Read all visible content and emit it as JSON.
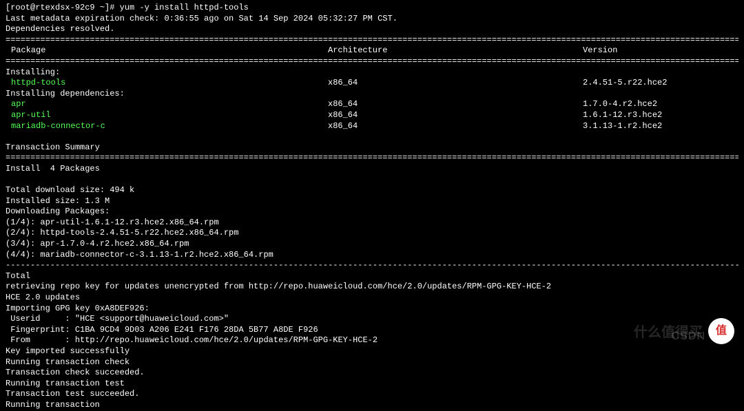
{
  "prompt": "[root@rtexdsx-92c9 ~]# yum -y install httpd-tools",
  "meta_expire": "Last metadata expiration check: 0:36:55 ago on Sat 14 Sep 2024 05:32:27 PM CST.",
  "deps_resolved": "Dependencies resolved.",
  "headers": {
    "pkg": "Package",
    "arch": "Architecture",
    "ver": "Version"
  },
  "installing_label": "Installing:",
  "installing": [
    {
      "name": "httpd-tools",
      "arch": "x86_64",
      "ver": "2.4.51-5.r22.hce2"
    }
  ],
  "deps_label": "Installing dependencies:",
  "deps": [
    {
      "name": "apr",
      "arch": "x86_64",
      "ver": "1.7.0-4.r2.hce2"
    },
    {
      "name": "apr-util",
      "arch": "x86_64",
      "ver": "1.6.1-12.r3.hce2"
    },
    {
      "name": "mariadb-connector-c",
      "arch": "x86_64",
      "ver": "3.1.13-1.r2.hce2"
    }
  ],
  "summary_label": "Transaction Summary",
  "install_count": "Install  4 Packages",
  "dl_size": "Total download size: 494 k",
  "inst_size": "Installed size: 1.3 M",
  "dl_label": "Downloading Packages:",
  "downloads": [
    "(1/4): apr-util-1.6.1-12.r3.hce2.x86_64.rpm",
    "(2/4): httpd-tools-2.4.51-5.r22.hce2.x86_64.rpm",
    "(3/4): apr-1.7.0-4.r2.hce2.x86_64.rpm",
    "(4/4): mariadb-connector-c-3.1.13-1.r2.hce2.x86_64.rpm"
  ],
  "total": "Total",
  "repo_key": "retrieving repo key for updates unencrypted from http://repo.huaweicloud.com/hce/2.0/updates/RPM-GPG-KEY-HCE-2",
  "hce": "HCE 2.0 updates",
  "gpg_import": "Importing GPG key 0xA8DEF926:",
  "gpg_userid": " Userid     : \"HCE <support@huaweicloud.com>\"",
  "gpg_fp": " Fingerprint: C1BA 9CD4 9D03 A206 E241 F176 28DA 5B77 A8DE F926",
  "gpg_from": " From       : http://repo.huaweicloud.com/hce/2.0/updates/RPM-GPG-KEY-HCE-2",
  "trail": [
    "Key imported successfully",
    "Running transaction check",
    "Transaction check succeeded.",
    "Running transaction test",
    "Transaction test succeeded.",
    "Running transaction"
  ],
  "sep": "====================================================================================================================================================================================",
  "dash": "------------------------------------------------------------------------------------------------------------------------------------------------------------------------------------",
  "watermarks": {
    "csdn": "CSDN",
    "smzdm_text": "什么值得买",
    "smzdm_icon": "值"
  }
}
